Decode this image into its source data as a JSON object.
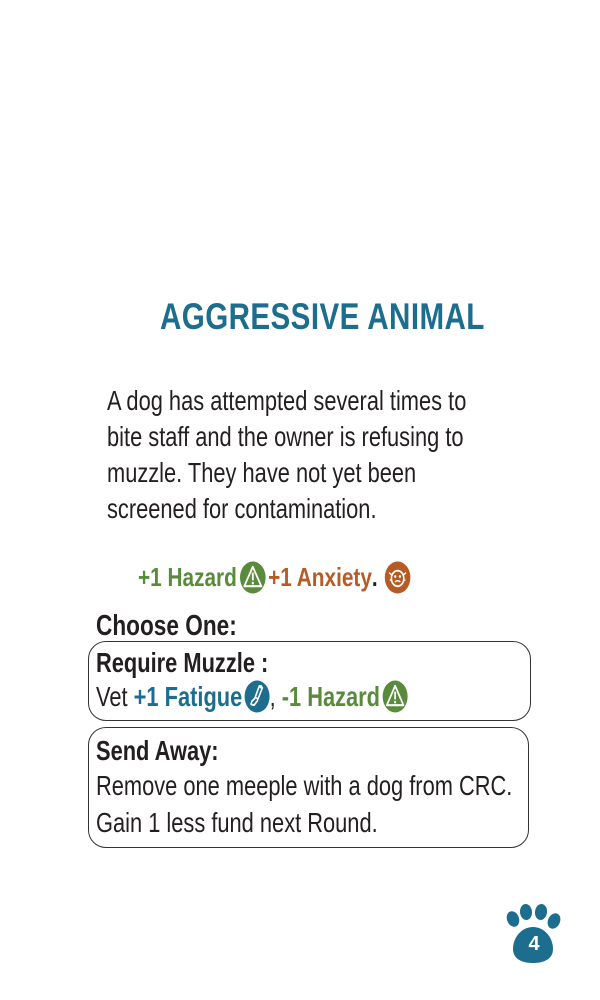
{
  "card": {
    "title": "AGGRESSIVE ANIMAL",
    "description": [
      "A dog has attempted several times to",
      "bite staff and the owner is refusing to",
      "muzzle. They have not yet been",
      "screened for contamination."
    ],
    "effect": {
      "hazard": "+1 Hazard",
      "anxiety": "+1 Anxiety",
      "separator": "."
    },
    "choose_label": "Choose One:",
    "options": [
      {
        "title": "Require Muzzle :",
        "prefix": "Vet ",
        "fatigue": "+1 Fatigue",
        "comma": ", ",
        "hazard": "-1 Hazard"
      },
      {
        "title": "Send Away:",
        "lines": [
          "Remove one meeple with a dog from CRC.",
          "Gain 1 less fund next Round."
        ]
      }
    ],
    "card_number": "4"
  },
  "colors": {
    "title": "#1d6d8f",
    "hazard": "#5a8a3c",
    "anxiety": "#b65b26",
    "fatigue": "#1d6d8f",
    "paw": "#1d6d8f"
  },
  "icons": {
    "hazard": "warning-triangle-icon",
    "anxiety": "anxious-face-icon",
    "fatigue": "leg-cast-icon",
    "card_badge": "paw-print-icon"
  }
}
